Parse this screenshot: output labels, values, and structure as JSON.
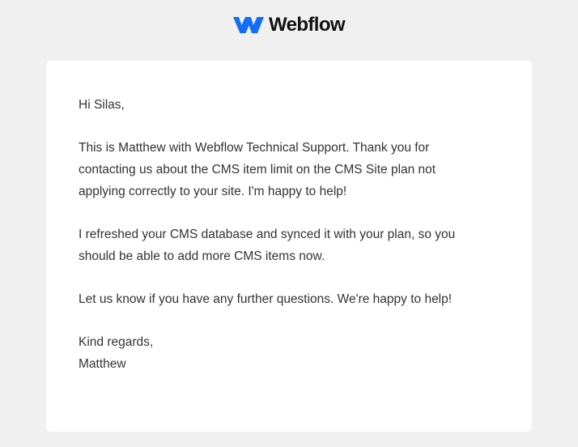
{
  "header": {
    "brand_name": "Webflow",
    "logo_icon": "webflow-w-icon",
    "brand_color": "#146ef5"
  },
  "email": {
    "greeting": "Hi Silas,",
    "paragraphs": [
      "This is Matthew with Webflow Technical Support. Thank you for contacting us about the CMS item limit on the CMS Site plan not applying correctly to your site. I'm happy to help!",
      "I refreshed your CMS database and synced it with your plan, so you should be able to add more CMS items now.",
      "Let us know if you have any further questions. We're happy to help!"
    ],
    "closing": "Kind regards,",
    "signature": "Matthew"
  },
  "colors": {
    "page_background": "#f0f0f0",
    "card_background": "#ffffff",
    "body_text": "#333333"
  }
}
